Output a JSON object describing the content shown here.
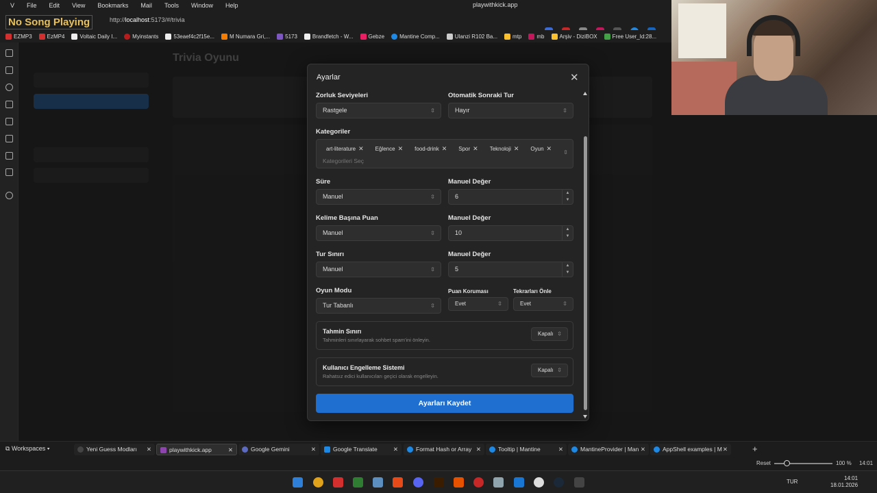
{
  "browser": {
    "menu": [
      "File",
      "Edit",
      "View",
      "Bookmarks",
      "Mail",
      "Tools",
      "Window",
      "Help"
    ],
    "window_title": "playwithkick.app",
    "overlay_text": "No Song Playing",
    "url_prefix": "http://",
    "url_host": "localhost",
    "url_rest": ":5173/#/trivia",
    "bookmarks": [
      "EZMP3",
      "EzMP4",
      "Voltaic Daily I...",
      "Myinstants",
      "53eaef4c2f15e...",
      "M Numara Gri,...",
      "5173",
      "Brandfetch - W...",
      "Gebze",
      "Mantine Comp...",
      "Ulanzi R102 Ba...",
      "mtp",
      "mb",
      "Arşiv - DiziBOX",
      "Free User_Id:28..."
    ]
  },
  "background": {
    "title": "Trivia Oyunu"
  },
  "modal": {
    "title": "Ayarlar",
    "difficulty": {
      "label": "Zorluk Seviyeleri",
      "value": "Rastgele"
    },
    "auto_next": {
      "label": "Otomatik Sonraki Tur",
      "value": "Hayır"
    },
    "categories": {
      "label": "Kategoriler",
      "tags": [
        "art-literature",
        "Eğlence",
        "food-drink",
        "Spor",
        "Teknoloji",
        "Oyun"
      ],
      "placeholder": "Kategorileri Seç"
    },
    "duration": {
      "label": "Süre",
      "value": "Manuel",
      "manual_label": "Manuel Değer",
      "manual_value": "6"
    },
    "points": {
      "label": "Kelime Başına Puan",
      "value": "Manuel",
      "manual_label": "Manuel Değer",
      "manual_value": "10"
    },
    "round_limit": {
      "label": "Tur Sınırı",
      "value": "Manuel",
      "manual_label": "Manuel Değer",
      "manual_value": "5"
    },
    "game_mode": {
      "label": "Oyun Modu",
      "value": "Tur Tabanlı"
    },
    "point_protection": {
      "label": "Puan Koruması",
      "value": "Evet"
    },
    "prevent_repeat": {
      "label": "Tekrarları Önle",
      "value": "Evet"
    },
    "guess_limit": {
      "title": "Tahmin Sınırı",
      "desc": "Tahminleri sınırlayarak sohbet spam'ini önleyin.",
      "value": "Kapalı"
    },
    "user_block": {
      "title": "Kullanıcı Engelleme Sistemi",
      "desc": "Rahatsız edici kullanıcıları geçici olarak engelleyin.",
      "value": "Kapalı"
    },
    "save_label": "Ayarları Kaydet"
  },
  "tabs": {
    "workspaces": "Workspaces",
    "items": [
      "Yeni Guess Modları",
      "playwithkick.app",
      "Google Gemini",
      "Google Translate",
      "Format Hash or Array",
      "Tooltip | Mantine",
      "MantineProvider | Man",
      "AppShell examples | M"
    ]
  },
  "status": {
    "reset": "Reset",
    "zoom": "100 %",
    "time_short": "14:01"
  },
  "taskbar": {
    "lang": "TUR",
    "time": "14:01",
    "date": "18.01.2026"
  }
}
